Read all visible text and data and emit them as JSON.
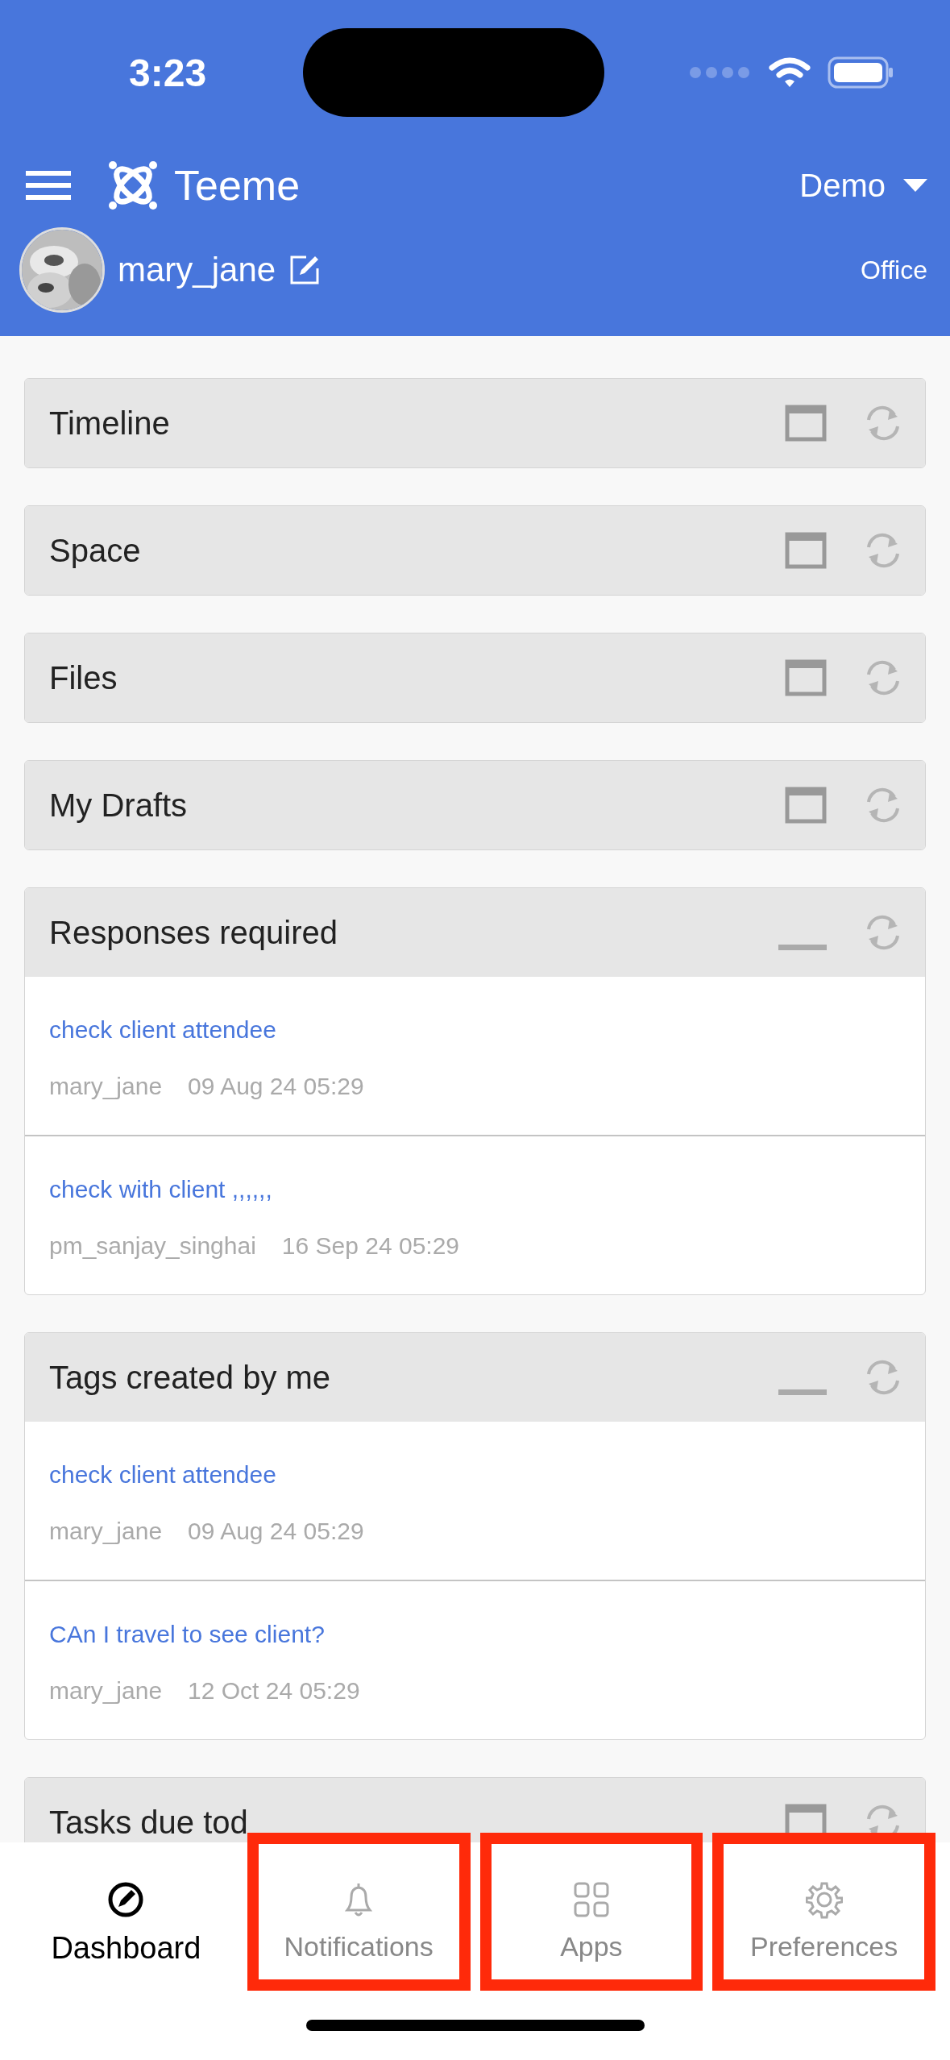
{
  "status_bar": {
    "time": "3:23"
  },
  "header": {
    "app_name": "Teeme",
    "workspace": "Demo",
    "user": "mary_jane",
    "role": "Office"
  },
  "panels": [
    {
      "title": "Timeline",
      "collapsed": true
    },
    {
      "title": "Space",
      "collapsed": true
    },
    {
      "title": "Files",
      "collapsed": true
    },
    {
      "title": "My Drafts",
      "collapsed": true
    },
    {
      "title": "Responses required",
      "collapsed": false,
      "items": [
        {
          "title": "check client attendee",
          "author": "mary_jane",
          "date": "09 Aug 24 05:29"
        },
        {
          "title": "check with client ,,,,,,",
          "author": "pm_sanjay_singhai",
          "date": "16 Sep 24 05:29"
        }
      ]
    },
    {
      "title": "Tags created by me",
      "collapsed": false,
      "items": [
        {
          "title": "check client attendee",
          "author": "mary_jane",
          "date": "09 Aug 24 05:29"
        },
        {
          "title": "CAn I travel to see client?",
          "author": "mary_jane",
          "date": "12 Oct 24 05:29"
        }
      ]
    },
    {
      "title": "Tasks due tod",
      "collapsed": true
    }
  ],
  "tab_bar": [
    {
      "kind": "dashboard",
      "label": "Dashboard",
      "selected": true,
      "highlighted": false
    },
    {
      "kind": "notifications",
      "label": "Notifications",
      "selected": false,
      "highlighted": true
    },
    {
      "kind": "apps",
      "label": "Apps",
      "selected": false,
      "highlighted": true
    },
    {
      "kind": "preferences",
      "label": "Preferences",
      "selected": false,
      "highlighted": true
    }
  ]
}
